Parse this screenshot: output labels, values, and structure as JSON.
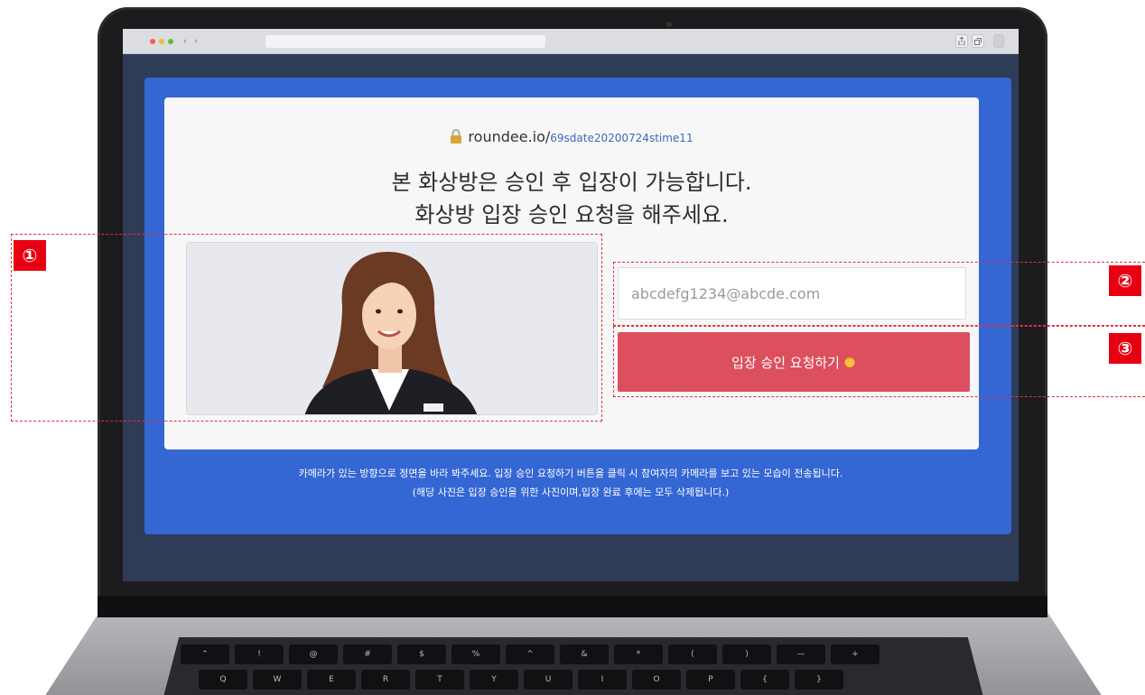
{
  "page": {
    "url_domain": "roundee.io/",
    "url_path": "69sdate20200724stime11",
    "heading_line1": "본 화상방은 승인 후 입장이 가능합니다.",
    "heading_line2": "화상방 입장 승인 요청을 해주세요.",
    "email_placeholder": "abcdefg1234@abcde.com",
    "request_button_label": "입장 승인 요청하기",
    "bottom_text_line1": "카메라가 있는 방향으로 정면을 바라 봐주세요. 입장 승인 요청하기 버튼을 클릭 시 참여자의 카메라를 보고 있는 모습이 전송됩니다.",
    "bottom_text_line2": "(해당 사진은 입장 승인을 위한 사진이며,입장 완료 후에는 모두 삭제됩니다.)"
  },
  "browser": {
    "back_glyph": "‹",
    "forward_glyph": "›"
  },
  "annotations": {
    "badge_1": "①",
    "badge_2": "②",
    "badge_3": "③"
  },
  "keyboard": {
    "row1": [
      "⌃",
      "!",
      "@",
      "#",
      "$",
      "%",
      "^",
      "&",
      "*",
      "(",
      ")",
      "—",
      "+"
    ],
    "row2": [
      "Q",
      "W",
      "E",
      "R",
      "T",
      "Y",
      "U",
      "I",
      "O",
      "P",
      "{",
      "}"
    ]
  },
  "icons": {
    "lock": "lock-icon",
    "wave": "waving-hand-icon"
  },
  "colors": {
    "page_blue": "#3466d4",
    "button_red": "#dc4f5e",
    "annotation_red": "#e60012"
  }
}
